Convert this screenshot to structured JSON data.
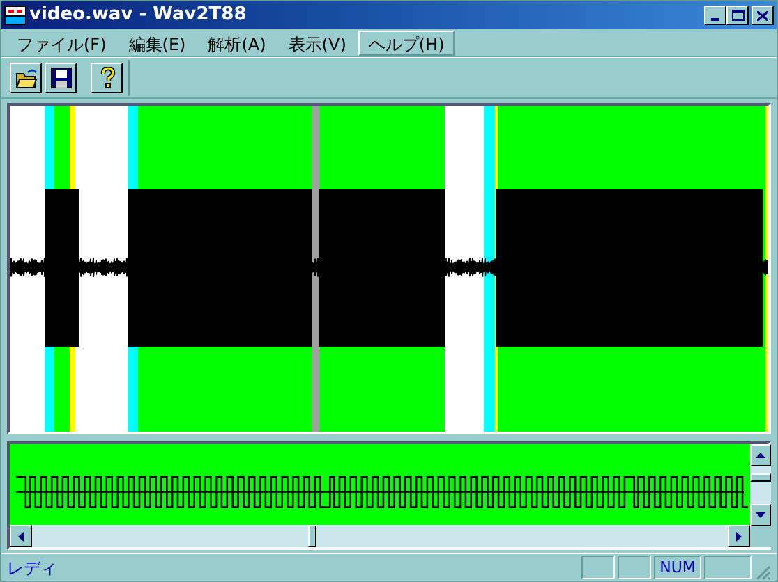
{
  "window": {
    "title": "video.wav - Wav2T88"
  },
  "menu": [
    {
      "label": "ファイル(F)",
      "selected": false
    },
    {
      "label": "編集(E)",
      "selected": false
    },
    {
      "label": "解析(A)",
      "selected": false
    },
    {
      "label": "表示(V)",
      "selected": false
    },
    {
      "label": "ヘルプ(H)",
      "selected": true
    }
  ],
  "toolbar": [
    {
      "kind": "open"
    },
    {
      "kind": "save"
    },
    {
      "kind": "help"
    }
  ],
  "status_bar": {
    "text": "レディ",
    "indicators": [
      "NUM"
    ]
  }
}
